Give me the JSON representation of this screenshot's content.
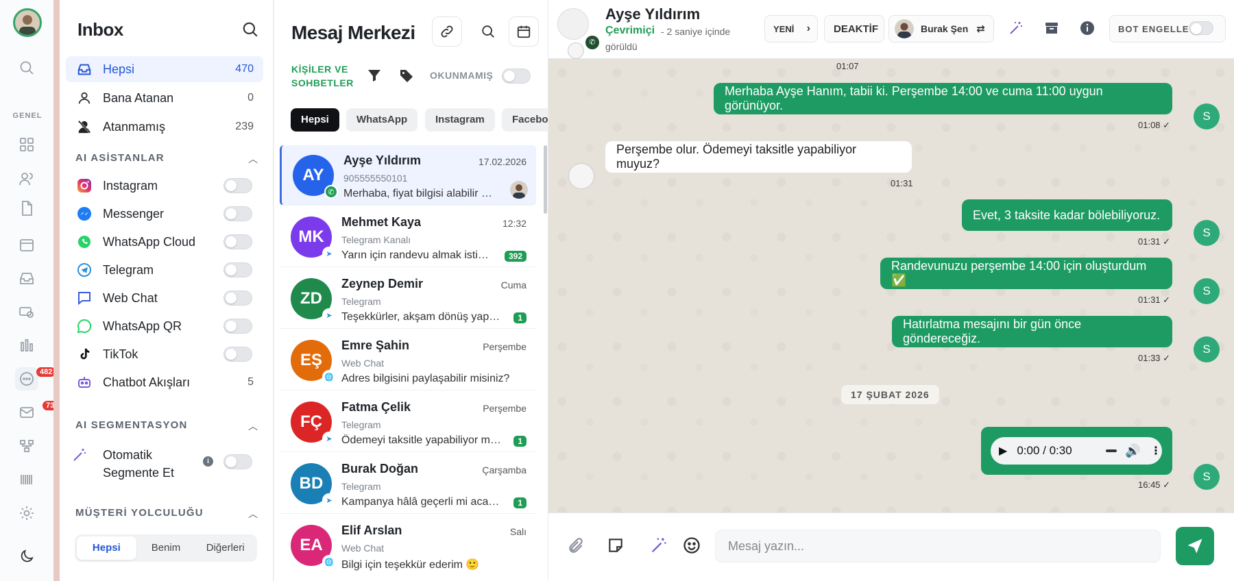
{
  "rail": {
    "section_label": "GENEL",
    "chat_badge": "482",
    "mail_badge": "73"
  },
  "inbox": {
    "title": "Inbox",
    "nav": [
      {
        "label": "Hepsi",
        "count": "470"
      },
      {
        "label": "Bana Atanan",
        "count": "0"
      },
      {
        "label": "Atanmamış",
        "count": "239"
      }
    ],
    "ai_section": "AI ASİSTANLAR",
    "assistants": [
      {
        "label": "Instagram"
      },
      {
        "label": "Messenger"
      },
      {
        "label": "WhatsApp Cloud"
      },
      {
        "label": "Telegram"
      },
      {
        "label": "Web Chat"
      },
      {
        "label": "WhatsApp QR"
      },
      {
        "label": "TikTok"
      }
    ],
    "chatbot": {
      "label": "Chatbot Akışları",
      "count": "5"
    },
    "seg_section": "AI SEGMENTASYON",
    "seg_item": {
      "line1": "Otomatik",
      "line2": "Segmente Et"
    },
    "journey_section": "MÜŞTERİ YOLCULUĞU",
    "tabs": [
      "Hepsi",
      "Benim",
      "Diğerleri"
    ]
  },
  "center": {
    "title": "Mesaj Merkezi",
    "filter_label_1": "KİŞİLER VE",
    "filter_label_2": "SOHBETLER",
    "unread_label": "OKUNMAMIŞ",
    "chips": [
      "Hepsi",
      "WhatsApp",
      "Instagram",
      "Facebo"
    ],
    "conversations": [
      {
        "initials": "AY",
        "name": "Ayşe Yıldırım",
        "date": "17.02.2026",
        "channel": "905555550101",
        "preview": "Merhaba, fiyat bilgisi alabilir misiniz?",
        "unread": "",
        "color": "#2563eb"
      },
      {
        "initials": "MK",
        "name": "Mehmet Kaya",
        "date": "12:32",
        "channel": "Telegram Kanalı",
        "preview": "Yarın için randevu almak istiyorum",
        "unread": "392",
        "color": "#7c3aed"
      },
      {
        "initials": "ZD",
        "name": "Zeynep Demir",
        "date": "Cuma",
        "channel": "Telegram",
        "preview": "Teşekkürler, akşam dönüş yapacağım",
        "unread": "1",
        "color": "#1f9d55"
      },
      {
        "initials": "EŞ",
        "name": "Emre Şahin",
        "date": "Perşembe",
        "channel": "Web Chat",
        "preview": "Adres bilgisini paylaşabilir misiniz?",
        "unread": "",
        "color": "#e36c0a"
      },
      {
        "initials": "FÇ",
        "name": "Fatma Çelik",
        "date": "Perşembe",
        "channel": "Telegram",
        "preview": "Ödemeyi taksitle yapabiliyor muyuz?",
        "unread": "1",
        "color": "#dc2626"
      },
      {
        "initials": "BD",
        "name": "Burak Doğan",
        "date": "Çarşamba",
        "channel": "Telegram",
        "preview": "Kampanya hâlâ geçerli mi acaba?",
        "unread": "1",
        "color": "#1a7fb5"
      },
      {
        "initials": "EA",
        "name": "Elif Arslan",
        "date": "Salı",
        "channel": "Web Chat",
        "preview": "Bilgi için teşekkür ederim 🙂",
        "unread": "",
        "color": "#db2777"
      }
    ]
  },
  "chat": {
    "contact_name": "Ayşe Yıldırım",
    "status": "Çevrimiçi",
    "last_seen": "- 2 saniye içinde",
    "last_seen_2": "görüldü",
    "stage_button": "YENİ",
    "deactivate_button": "DEAKTİF",
    "agent_name": "Burak Şen",
    "bot_block_label": "BOT ENGELLE",
    "top_time": "01:07",
    "messages": [
      {
        "dir": "out",
        "text": "Merhaba Ayşe Hanım, tabii ki. Perşembe 14:00 ve cuma 11:00 uygun görünüyor.",
        "time": "01:08 ✓"
      },
      {
        "dir": "in",
        "text": "Perşembe olur. Ödemeyi taksitle yapabiliyor muyuz?",
        "time": "01:31"
      },
      {
        "dir": "out",
        "text": "Evet, 3 taksite kadar bölebiliyoruz.",
        "time": "01:31 ✓"
      },
      {
        "dir": "out",
        "text": "Randevunuzu perşembe 14:00 için oluşturdum ✅",
        "time": "01:31 ✓"
      },
      {
        "dir": "out",
        "text": "Hatırlatma mesajını bir gün önce göndereceğiz.",
        "time": "01:33 ✓"
      }
    ],
    "avatar_letter": "S",
    "date_divider": "17 ŞUBAT 2026",
    "audio": {
      "time_label": "0:00 / 0:30",
      "time": "16:45 ✓"
    },
    "composer_placeholder": "Mesaj yazın..."
  }
}
